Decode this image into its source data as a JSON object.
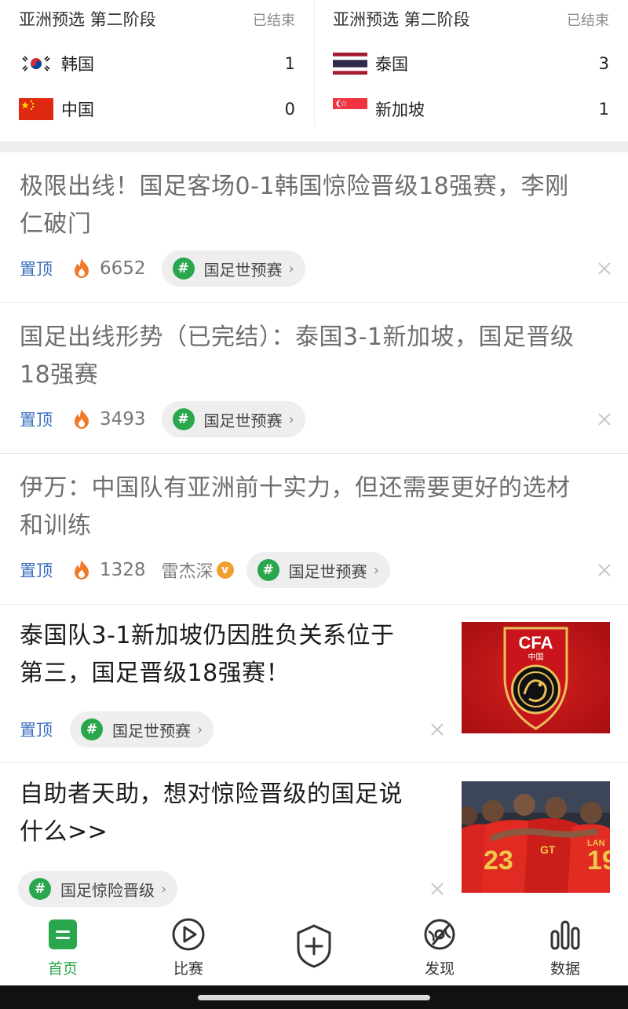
{
  "matches": [
    {
      "title": "亚洲预选 第二阶段",
      "status": "已结束",
      "team1": {
        "name": "韩国",
        "score": "1",
        "flag_icon": "korea-flag-icon"
      },
      "team2": {
        "name": "中国",
        "score": "0",
        "flag_icon": "china-flag-icon"
      }
    },
    {
      "title": "亚洲预选 第二阶段",
      "status": "已结束",
      "team1": {
        "name": "泰国",
        "score": "3",
        "flag_icon": "thailand-flag-icon"
      },
      "team2": {
        "name": "新加坡",
        "score": "1",
        "flag_icon": "singapore-flag-icon"
      }
    }
  ],
  "news": [
    {
      "title_line1": "极限出线！国足客场0-1韩国惊险晋级18强赛，李刚",
      "title_line2": "仁破门",
      "pin": "置顶",
      "hot": "6652",
      "tag": "国足世预赛"
    },
    {
      "title_line1": "国足出线形势（已完结）：泰国3-1新加坡，国足晋级",
      "title_line2": "18强赛",
      "pin": "置顶",
      "hot": "3493",
      "tag": "国足世预赛"
    },
    {
      "title_line1": "伊万：中国队有亚洲前十实力，但还需要更好的选材",
      "title_line2": "和训练",
      "pin": "置顶",
      "hot": "1328",
      "author": "雷杰深",
      "tag": "国足世预赛"
    },
    {
      "title_line1": "泰国队3-1新加坡仍因胜负关系位于",
      "title_line2": "第三，国足晋级18强赛！",
      "pin": "置顶",
      "tag": "国足世预赛",
      "thumb_text": "CFA",
      "thumb_sub": "中国"
    },
    {
      "title_line1": "自助者天助，想对惊险晋级的国足说",
      "title_line2": "什么>>",
      "tag": "国足惊险晋级",
      "thumb_numbers": [
        "23",
        "GT",
        "19",
        "LAN"
      ]
    }
  ],
  "tabs": [
    {
      "label": "首页",
      "icon": "home-icon",
      "active": true
    },
    {
      "label": "比赛",
      "icon": "play-icon",
      "active": false
    },
    {
      "label": "",
      "icon": "shield-plus-icon",
      "active": false
    },
    {
      "label": "发现",
      "icon": "discover-icon",
      "active": false
    },
    {
      "label": "数据",
      "icon": "data-bars-icon",
      "active": false
    }
  ],
  "colors": {
    "brand_green": "#2aa74c",
    "pin_blue": "#3b6fbf",
    "fire_orange": "#f07a2a"
  }
}
